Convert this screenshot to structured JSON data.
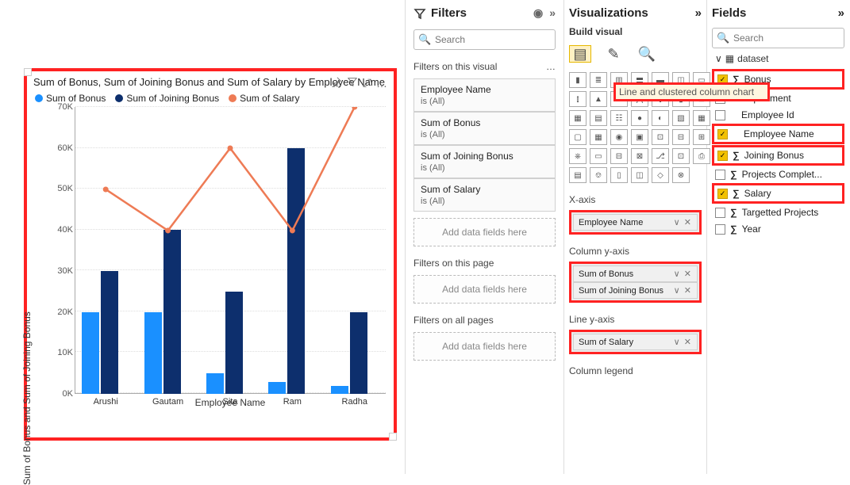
{
  "chart_data": {
    "type": "bar-line",
    "title": "Sum of Bonus, Sum of Joining Bonus and Sum of Salary by Employee Name",
    "xlabel": "Employee Name",
    "ylabel": "Sum of Bonus and Sum of Joining Bonus",
    "categories": [
      "Arushi",
      "Gautam",
      "Sita",
      "Ram",
      "Radha"
    ],
    "yticks": [
      "0K",
      "10K",
      "20K",
      "30K",
      "40K",
      "50K",
      "60K",
      "70K"
    ],
    "ylim": [
      0,
      70
    ],
    "series": [
      {
        "name": "Sum of Bonus",
        "type": "bar",
        "color": "#1a90ff",
        "values": [
          20,
          20,
          5,
          3,
          2
        ]
      },
      {
        "name": "Sum of Joining Bonus",
        "type": "bar",
        "color": "#0d2f6d",
        "values": [
          30,
          40,
          25,
          60,
          20
        ]
      },
      {
        "name": "Sum of Salary",
        "type": "line",
        "color": "#ee7b55",
        "values": [
          50,
          40,
          60,
          40,
          70
        ]
      }
    ],
    "legend": [
      "Sum of Bonus",
      "Sum of Joining Bonus",
      "Sum of Salary"
    ]
  },
  "chart_icons": {
    "pin": "📌",
    "filter": "▽",
    "focus": "⤢",
    "more": "…"
  },
  "filters": {
    "title": "Filters",
    "search_placeholder": "Search",
    "sections": {
      "visual": {
        "title": "Filters on this visual",
        "cards": [
          {
            "name": "Employee Name",
            "sub": "is (All)"
          },
          {
            "name": "Sum of Bonus",
            "sub": "is (All)"
          },
          {
            "name": "Sum of Joining Bonus",
            "sub": "is (All)"
          },
          {
            "name": "Sum of Salary",
            "sub": "is (All)"
          }
        ],
        "add": "Add data fields here"
      },
      "page": {
        "title": "Filters on this page",
        "add": "Add data fields here"
      },
      "all": {
        "title": "Filters on all pages",
        "add": "Add data fields here"
      }
    }
  },
  "viz": {
    "title": "Visualizations",
    "build": "Build visual",
    "tooltip": "Line and clustered column chart",
    "wells": {
      "xaxis": {
        "label": "X-axis",
        "items": [
          "Employee Name"
        ]
      },
      "colY": {
        "label": "Column y-axis",
        "items": [
          "Sum of Bonus",
          "Sum of Joining Bonus"
        ]
      },
      "lineY": {
        "label": "Line y-axis",
        "items": [
          "Sum of Salary"
        ]
      },
      "legend": {
        "label": "Column legend"
      }
    }
  },
  "fields": {
    "title": "Fields",
    "search_placeholder": "Search",
    "dataset": "dataset",
    "items": [
      {
        "name": "Bonus",
        "sigma": true,
        "checked": true,
        "hl": true
      },
      {
        "name": "Department",
        "sigma": false,
        "checked": false,
        "hl": false
      },
      {
        "name": "Employee Id",
        "sigma": false,
        "checked": false,
        "hl": false
      },
      {
        "name": "Employee Name",
        "sigma": false,
        "checked": true,
        "hl": true
      },
      {
        "name": "Joining Bonus",
        "sigma": true,
        "checked": true,
        "hl": true
      },
      {
        "name": "Projects Complet...",
        "sigma": true,
        "checked": false,
        "hl": false
      },
      {
        "name": "Salary",
        "sigma": true,
        "checked": true,
        "hl": true
      },
      {
        "name": "Targetted Projects",
        "sigma": true,
        "checked": false,
        "hl": false
      },
      {
        "name": "Year",
        "sigma": true,
        "checked": false,
        "hl": false
      }
    ]
  }
}
